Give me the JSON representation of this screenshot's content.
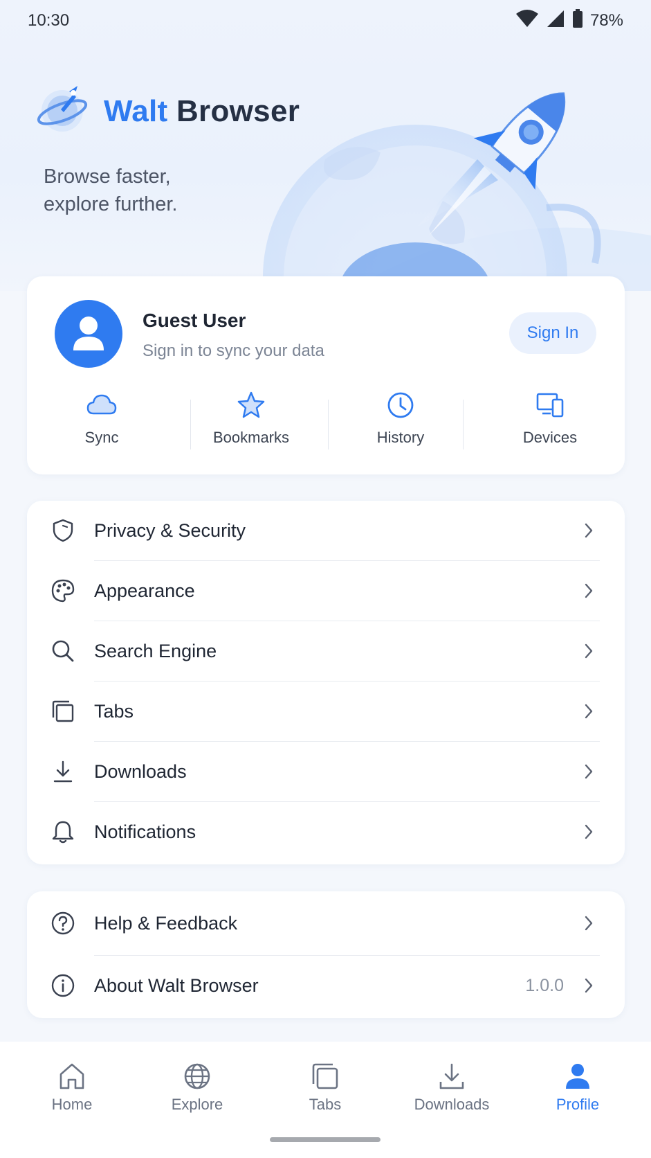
{
  "status": {
    "time": "10:30",
    "battery": "78%"
  },
  "brand": {
    "name_part1": "Walt",
    "name_part2": "Browser",
    "tagline_line1": "Browse faster,",
    "tagline_line2": "explore further."
  },
  "user": {
    "name": "Guest User",
    "subtitle": "Sign in to sync your data",
    "signin_label": "Sign In"
  },
  "quick_actions": [
    {
      "label": "Sync",
      "icon": "cloud-icon"
    },
    {
      "label": "Bookmarks",
      "icon": "star-icon"
    },
    {
      "label": "History",
      "icon": "clock-icon"
    },
    {
      "label": "Devices",
      "icon": "devices-icon"
    }
  ],
  "settings": [
    {
      "label": "Privacy & Security",
      "icon": "shield-icon"
    },
    {
      "label": "Appearance",
      "icon": "palette-icon"
    },
    {
      "label": "Search Engine",
      "icon": "search-icon"
    },
    {
      "label": "Tabs",
      "icon": "tabs-icon"
    },
    {
      "label": "Downloads",
      "icon": "download-icon"
    },
    {
      "label": "Notifications",
      "icon": "bell-icon"
    }
  ],
  "support": [
    {
      "label": "Help & Feedback",
      "icon": "help-icon"
    },
    {
      "label": "About Walt Browser",
      "icon": "info-icon",
      "value": "1.0.0"
    }
  ],
  "nav": [
    {
      "label": "Home",
      "icon": "home-icon"
    },
    {
      "label": "Explore",
      "icon": "globe-icon"
    },
    {
      "label": "Tabs",
      "icon": "tabs-icon"
    },
    {
      "label": "Downloads",
      "icon": "download-icon"
    },
    {
      "label": "Profile",
      "icon": "profile-icon",
      "active": true
    }
  ],
  "colors": {
    "accent": "#2f7bf0",
    "background": "#f4f7fc",
    "card": "#ffffff",
    "text": "#1f2633",
    "muted": "#7b8494"
  }
}
